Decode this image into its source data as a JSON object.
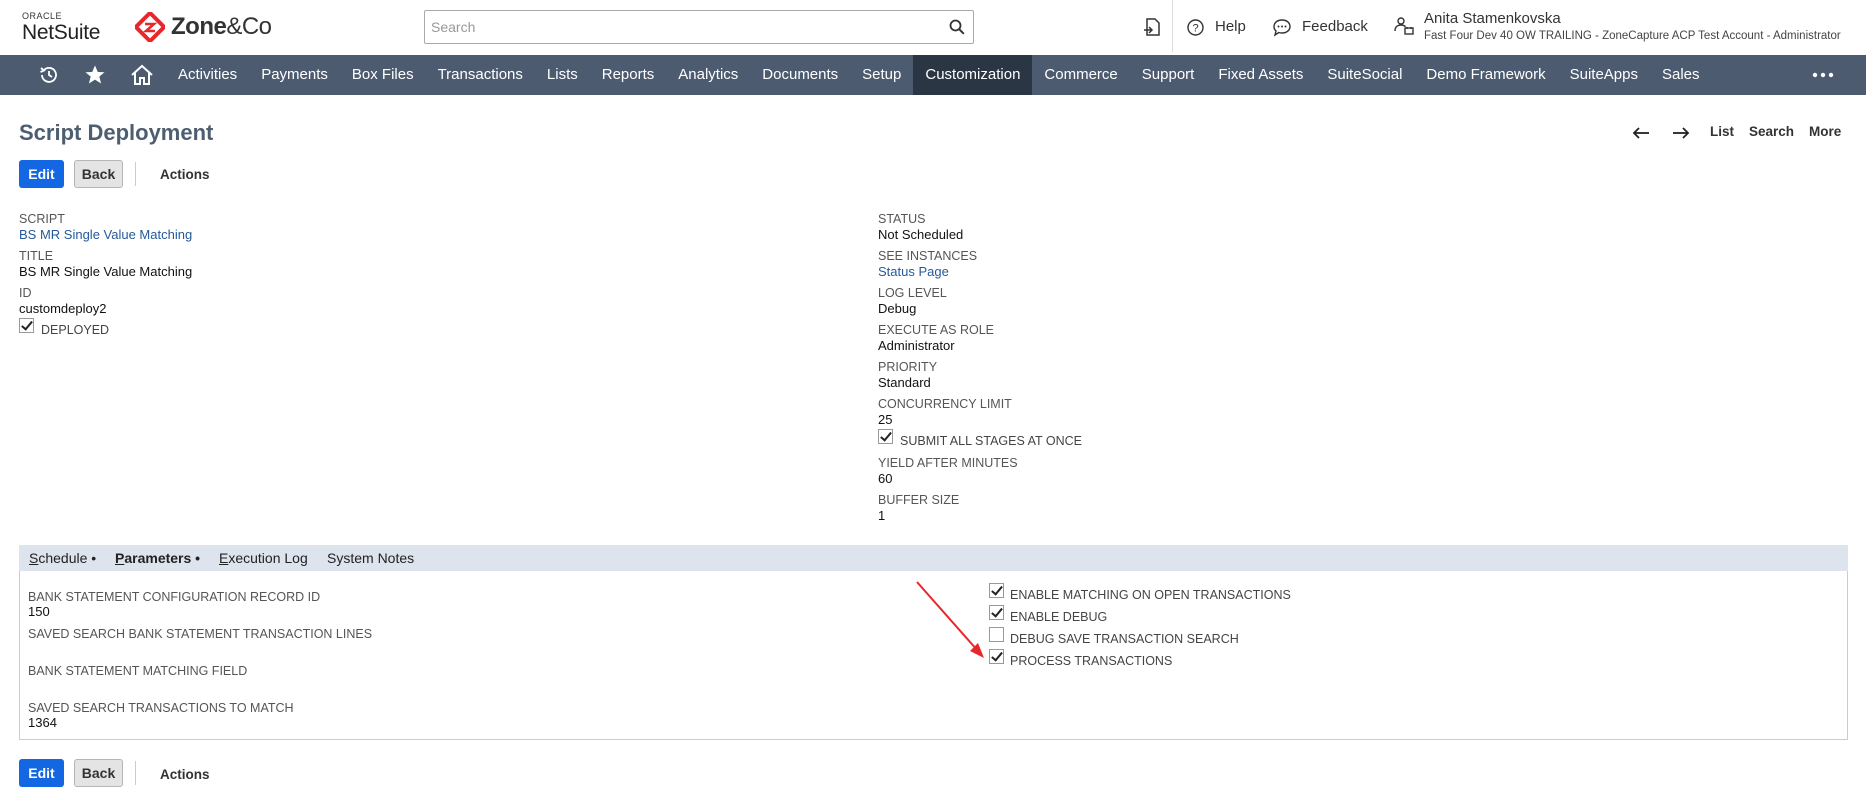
{
  "header": {
    "oracle_text": "ORACLE",
    "netsuite_text": "NetSuite",
    "brand_zone": "Zone",
    "brand_co": "&Co",
    "search_placeholder": "Search",
    "help_label": "Help",
    "feedback_label": "Feedback",
    "user_name": "Anita Stamenkovska",
    "user_account": "Fast Four Dev 40 OW TRAILING - ZoneCapture ACP Test Account - Administrator",
    "brand_color": "#e8262b"
  },
  "nav": {
    "items": [
      {
        "label": "Activities"
      },
      {
        "label": "Payments"
      },
      {
        "label": "Box Files"
      },
      {
        "label": "Transactions"
      },
      {
        "label": "Lists"
      },
      {
        "label": "Reports"
      },
      {
        "label": "Analytics"
      },
      {
        "label": "Documents"
      },
      {
        "label": "Setup"
      },
      {
        "label": "Customization",
        "active": true
      },
      {
        "label": "Commerce"
      },
      {
        "label": "Support"
      },
      {
        "label": "Fixed Assets"
      },
      {
        "label": "SuiteSocial"
      },
      {
        "label": "Demo Framework"
      },
      {
        "label": "SuiteApps"
      },
      {
        "label": "Sales"
      }
    ],
    "bg_color": "#4c5b70",
    "active_color": "#2b3645"
  },
  "page": {
    "title": "Script Deployment",
    "record_nav": {
      "list": "List",
      "search": "Search",
      "more": "More"
    }
  },
  "buttons": {
    "edit": "Edit",
    "back": "Back",
    "actions": "Actions",
    "edit_color": "#1467e2"
  },
  "left_fields": {
    "script_label": "SCRIPT",
    "script_value": "BS MR Single Value Matching",
    "title_label": "TITLE",
    "title_value": "BS MR Single Value Matching",
    "id_label": "ID",
    "id_value": "customdeploy2",
    "deployed_label": "DEPLOYED",
    "deployed_checked": true
  },
  "right_fields": {
    "status_label": "STATUS",
    "status_value": "Not Scheduled",
    "see_instances_label": "SEE INSTANCES",
    "see_instances_value": "Status Page",
    "log_level_label": "LOG LEVEL",
    "log_level_value": "Debug",
    "execute_as_role_label": "EXECUTE AS ROLE",
    "execute_as_role_value": "Administrator",
    "priority_label": "PRIORITY",
    "priority_value": "Standard",
    "concurrency_limit_label": "CONCURRENCY LIMIT",
    "concurrency_limit_value": "25",
    "submit_all_label": "SUBMIT ALL STAGES AT ONCE",
    "submit_all_checked": true,
    "yield_label": "YIELD AFTER MINUTES",
    "yield_value": "60",
    "buffer_label": "BUFFER SIZE",
    "buffer_value": "1"
  },
  "subtabs": {
    "schedule": {
      "first": "S",
      "rest": "chedule •"
    },
    "parameters": {
      "first": "P",
      "rest": "arameters •"
    },
    "execution_log": {
      "first": "E",
      "rest": "xecution Log"
    },
    "system_notes": "System Notes"
  },
  "parameters": {
    "left": {
      "bank_config_label": "BANK STATEMENT CONFIGURATION RECORD ID",
      "bank_config_value": "150",
      "saved_search_lines_label": "SAVED SEARCH BANK STATEMENT TRANSACTION LINES",
      "saved_search_lines_value": "",
      "matching_field_label": "BANK STATEMENT MATCHING FIELD",
      "matching_field_value": "",
      "saved_search_match_label": "SAVED SEARCH TRANSACTIONS TO MATCH",
      "saved_search_match_value": "1364"
    },
    "right": [
      {
        "label": "ENABLE MATCHING ON OPEN TRANSACTIONS",
        "checked": true
      },
      {
        "label": "ENABLE DEBUG",
        "checked": true
      },
      {
        "label": "DEBUG SAVE TRANSACTION SEARCH",
        "checked": false
      },
      {
        "label": "PROCESS TRANSACTIONS",
        "checked": true
      }
    ]
  },
  "annotation": {
    "arrow_color": "#e8262b"
  }
}
